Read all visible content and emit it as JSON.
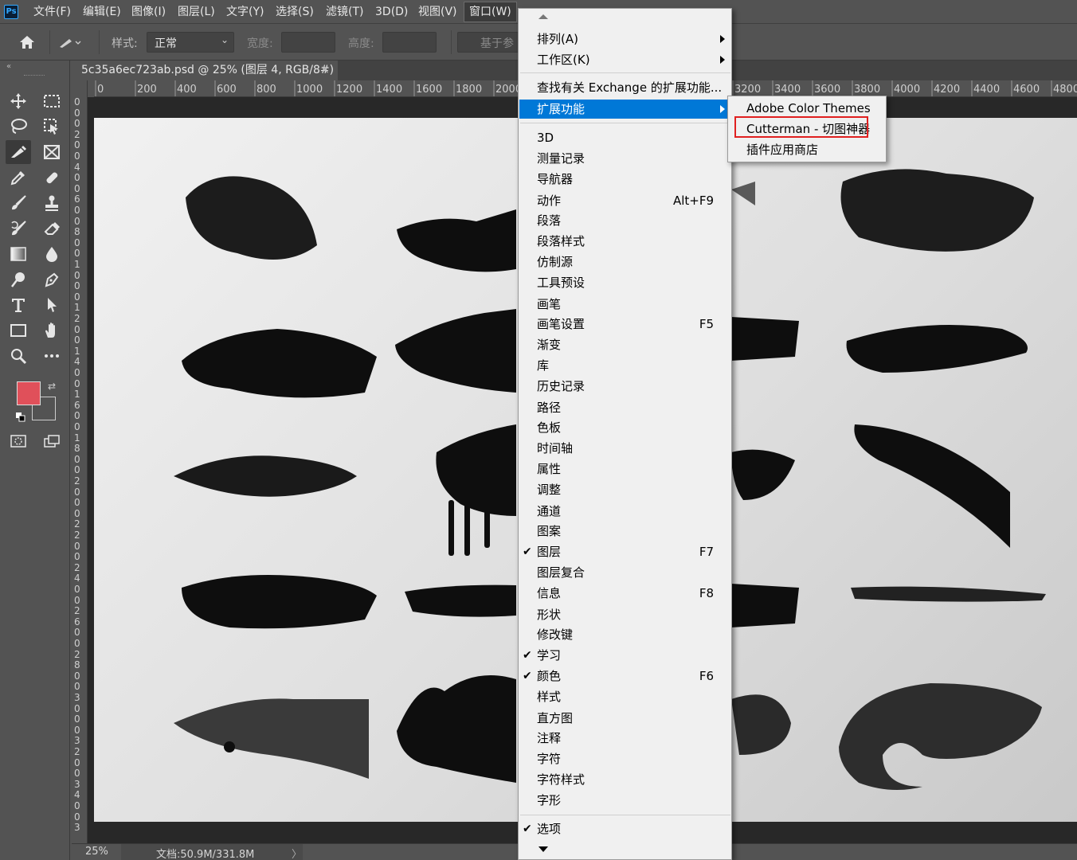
{
  "menubar": {
    "logo": "Ps",
    "items": [
      "文件(F)",
      "编辑(E)",
      "图像(I)",
      "图层(L)",
      "文字(Y)",
      "选择(S)",
      "滤镜(T)",
      "3D(D)",
      "视图(V)",
      "窗口(W)"
    ]
  },
  "options": {
    "style_label": "样式:",
    "style_value": "正常",
    "width_label": "宽度:",
    "height_label": "高度:",
    "base_label": "基于参"
  },
  "document": {
    "tab_title": "5c35a6ec723ab.psd @ 25% (图层 4, RGB/8#)",
    "close_glyph": "×"
  },
  "ruler": {
    "h_ticks": [
      "0",
      "200",
      "400",
      "600",
      "800",
      "1000",
      "1200",
      "1400",
      "1600",
      "1800",
      "2000",
      "3200",
      "3400",
      "3600",
      "3800",
      "4000",
      "4200",
      "4400",
      "4600",
      "4800"
    ],
    "v_ticks": [
      "0",
      "0",
      "0",
      "2",
      "0",
      "0",
      "4",
      "0",
      "0",
      "6",
      "0",
      "0",
      "8",
      "0",
      "0",
      "1",
      "0",
      "0",
      "0",
      "1",
      "2",
      "0",
      "0",
      "1",
      "4",
      "0",
      "0",
      "1",
      "6",
      "0",
      "0",
      "1",
      "8",
      "0",
      "0",
      "2",
      "0",
      "0",
      "0",
      "2",
      "2",
      "0",
      "0",
      "2",
      "4",
      "0",
      "0",
      "2",
      "6",
      "0",
      "0",
      "2",
      "8",
      "0",
      "0",
      "3",
      "0",
      "0",
      "0",
      "3",
      "2",
      "0",
      "0",
      "3",
      "4",
      "0",
      "0",
      "3"
    ]
  },
  "status": {
    "zoom": "25%",
    "doc_size": "文档:50.9M/331.8M",
    "arrow": "〉"
  },
  "colors": {
    "foreground": "#e0505a",
    "background": "#000000",
    "menu_highlight": "#0078d7",
    "callout_border": "#e02020"
  },
  "window_menu": {
    "items": [
      {
        "label": "排列(A)",
        "submenu": true
      },
      {
        "label": "工作区(K)",
        "submenu": true
      },
      {
        "label": "查找有关 Exchange 的扩展功能..."
      },
      {
        "label": "扩展功能",
        "submenu": true,
        "highlighted": true
      },
      {
        "label": "3D"
      },
      {
        "label": "测量记录"
      },
      {
        "label": "导航器"
      },
      {
        "label": "动作",
        "shortcut": "Alt+F9"
      },
      {
        "label": "段落"
      },
      {
        "label": "段落样式"
      },
      {
        "label": "仿制源"
      },
      {
        "label": "工具预设"
      },
      {
        "label": "画笔"
      },
      {
        "label": "画笔设置",
        "shortcut": "F5"
      },
      {
        "label": "渐变"
      },
      {
        "label": "库"
      },
      {
        "label": "历史记录"
      },
      {
        "label": "路径"
      },
      {
        "label": "色板"
      },
      {
        "label": "时间轴"
      },
      {
        "label": "属性"
      },
      {
        "label": "调整"
      },
      {
        "label": "通道"
      },
      {
        "label": "图案"
      },
      {
        "label": "图层",
        "shortcut": "F7",
        "checked": true
      },
      {
        "label": "图层复合"
      },
      {
        "label": "信息",
        "shortcut": "F8"
      },
      {
        "label": "形状"
      },
      {
        "label": "修改键"
      },
      {
        "label": "学习",
        "checked": true
      },
      {
        "label": "颜色",
        "shortcut": "F6",
        "checked": true
      },
      {
        "label": "样式"
      },
      {
        "label": "直方图"
      },
      {
        "label": "注释"
      },
      {
        "label": "字符"
      },
      {
        "label": "字符样式"
      },
      {
        "label": "字形"
      },
      {
        "label": "选项",
        "checked": true
      }
    ],
    "check_glyph": "✔"
  },
  "extensions_submenu": {
    "items": [
      "Adobe Color Themes",
      "Cutterman - 切图神器",
      "插件应用商店"
    ]
  },
  "tools": [
    "move-icon",
    "marquee-icon",
    "lasso-icon",
    "object-select-icon",
    "crop-icon",
    "frame-icon",
    "eyedropper-icon",
    "healing-icon",
    "brush-icon",
    "stamp-icon",
    "history-brush-icon",
    "eraser-icon",
    "gradient-icon",
    "blur-icon",
    "dodge-icon",
    "pen-icon",
    "type-icon",
    "path-select-icon",
    "rectangle-icon",
    "hand-icon",
    "zoom-icon",
    "more-icon"
  ]
}
